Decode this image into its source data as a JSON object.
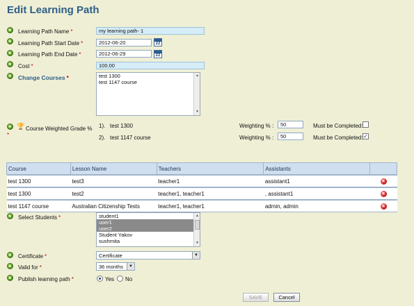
{
  "page": {
    "title": "Edit Learning Path"
  },
  "fields": {
    "name": {
      "label": "Learning Path Name",
      "value": "my learning path- 1"
    },
    "start_date": {
      "label": "Learning Path Start Date",
      "value": "2012-06-20"
    },
    "end_date": {
      "label": "Learning Path End Date",
      "value": "2012-06-29"
    },
    "cost": {
      "label": "Cost",
      "value": "100.00"
    },
    "required_mark": "*",
    "calendar_day": "22"
  },
  "courses": {
    "link_label": "Change Courses",
    "items": [
      "test 1300",
      "test 1147 course"
    ]
  },
  "grade": {
    "label": "Course Weighted Grade %",
    "weighting_label": "Weighting % :",
    "must_complete_label": "Must be Completed:",
    "rows": [
      {
        "index": "1).",
        "course": "test 1300",
        "weight": "50",
        "must_complete": false
      },
      {
        "index": "2).",
        "course": "test 1147 course",
        "weight": "50",
        "must_complete": true
      }
    ]
  },
  "lessons_table": {
    "headers": [
      "Course",
      "Lesson Name",
      "Teachers",
      "Assistants",
      ""
    ],
    "rows": [
      {
        "course": "test 1300",
        "lesson": "test3",
        "teachers": "teacher1",
        "assistants": "assistant1"
      },
      {
        "course": "test 1300",
        "lesson": "test2",
        "teachers": "teacher1, teacher1",
        "assistants": ", assistant1"
      },
      {
        "course": "test 1147 course",
        "lesson": "Australian Citizenship Tests",
        "teachers": "teacher1, teacher1",
        "assistants": "admin, admin"
      }
    ]
  },
  "students": {
    "label": "Select Students",
    "options": [
      {
        "name": "student1",
        "selected": false
      },
      {
        "name": "user1",
        "selected": true
      },
      {
        "name": "user2",
        "selected": true
      },
      {
        "name": "Student Yakov",
        "selected": false
      },
      {
        "name": "sushmita",
        "selected": false
      }
    ]
  },
  "certificate": {
    "label": "Certificate",
    "value": "Certificate"
  },
  "valid_for": {
    "label": "Valid for",
    "value": "36 months"
  },
  "publish": {
    "label": "Publish learning path",
    "yes": "Yes",
    "no": "No",
    "selected": "yes"
  },
  "actions": {
    "save": "SAVE",
    "cancel": "Cancel"
  },
  "colors": {
    "title": "#2d5f86",
    "background": "#efefd6",
    "header": "#cfdff0",
    "required": "#cc0000"
  }
}
